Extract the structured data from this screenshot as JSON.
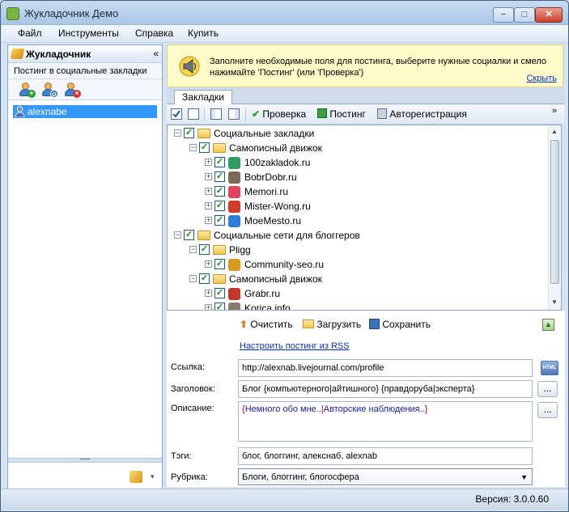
{
  "window": {
    "title": "Жукладочник Демо",
    "minimize": "−",
    "maximize": "□",
    "close": "✕"
  },
  "menu": [
    "Файл",
    "Инструменты",
    "Справка",
    "Купить"
  ],
  "left_panel": {
    "title": "Жукладочник",
    "collapse": "«",
    "subtitle": "Постинг в социальные закладки",
    "users": [
      {
        "name": "alexnabe",
        "selected": true
      }
    ],
    "splitter_grip": "•••••",
    "bottom_arrow": "▾"
  },
  "info": {
    "text": "Заполните необходимые поля для постинга, выберите нужные социалки и смело нажимайте 'Постинг' (или 'Проверка')",
    "hide_link": "Скрыть"
  },
  "tabs": {
    "active": "Закладки"
  },
  "toolbar": {
    "check": "Проверка",
    "post": "Постинг",
    "autoreg": "Авторегистрация",
    "more": "»"
  },
  "tree": [
    {
      "level": 0,
      "label": "Социальные закладки",
      "type": "folder",
      "expanded": true
    },
    {
      "level": 1,
      "label": "Самописный движок",
      "type": "folder",
      "expanded": true
    },
    {
      "level": 2,
      "label": "100zakladok.ru",
      "type": "site",
      "color": "#2e9c63"
    },
    {
      "level": 2,
      "label": "BobrDobr.ru",
      "type": "site",
      "color": "#7a6a58"
    },
    {
      "level": 2,
      "label": "Memori.ru",
      "type": "site",
      "color": "#e0445a"
    },
    {
      "level": 2,
      "label": "Mister-Wong.ru",
      "type": "site",
      "color": "#d23a2a"
    },
    {
      "level": 2,
      "label": "MoeMesto.ru",
      "type": "site",
      "color": "#2f7fd8"
    },
    {
      "level": 0,
      "label": "Социальные сети для блоггеров",
      "type": "folder",
      "expanded": true
    },
    {
      "level": 1,
      "label": "Pligg",
      "type": "folder",
      "expanded": true
    },
    {
      "level": 2,
      "label": "Community-seo.ru",
      "type": "site",
      "color": "#d79a1e"
    },
    {
      "level": 1,
      "label": "Самописный движок",
      "type": "folder",
      "expanded": true
    },
    {
      "level": 2,
      "label": "Grabr.ru",
      "type": "site",
      "color": "#c0392b"
    },
    {
      "level": 2,
      "label": "Korica.info",
      "type": "site",
      "color": "#8a7a6a"
    }
  ],
  "actions": {
    "clear": "Очистить",
    "load": "Загрузить",
    "save": "Сохранить"
  },
  "configure_link": "Настроить постинг из RSS",
  "form": {
    "link_label": "Ссылка:",
    "link_value": "http://alexnab.livejournal.com/profile",
    "html_badge": "HTML",
    "title_label": "Заголовок:",
    "title_value": "Блог {компьютерного|айтишного} {правдоруба|эксперта}",
    "desc_label": "Описание:",
    "desc_open": "{",
    "desc_part1": "Немного обо мне..",
    "desc_sep": "|",
    "desc_part2": "Авторские наблюдения..",
    "desc_close": "}",
    "tags_label": "Тэги:",
    "tags_value": "блог, блоггинг, алекснаб, alexnab",
    "rubric_label": "Рубрика:",
    "rubric_value": "Блоги, блоггинг, блогосфера",
    "dots": "..."
  },
  "status": {
    "version": "Версия: 3.0.0.60"
  },
  "colors": {
    "accent": "#3399ff",
    "link": "#0033cc",
    "info_bg": "#fffbc9"
  }
}
